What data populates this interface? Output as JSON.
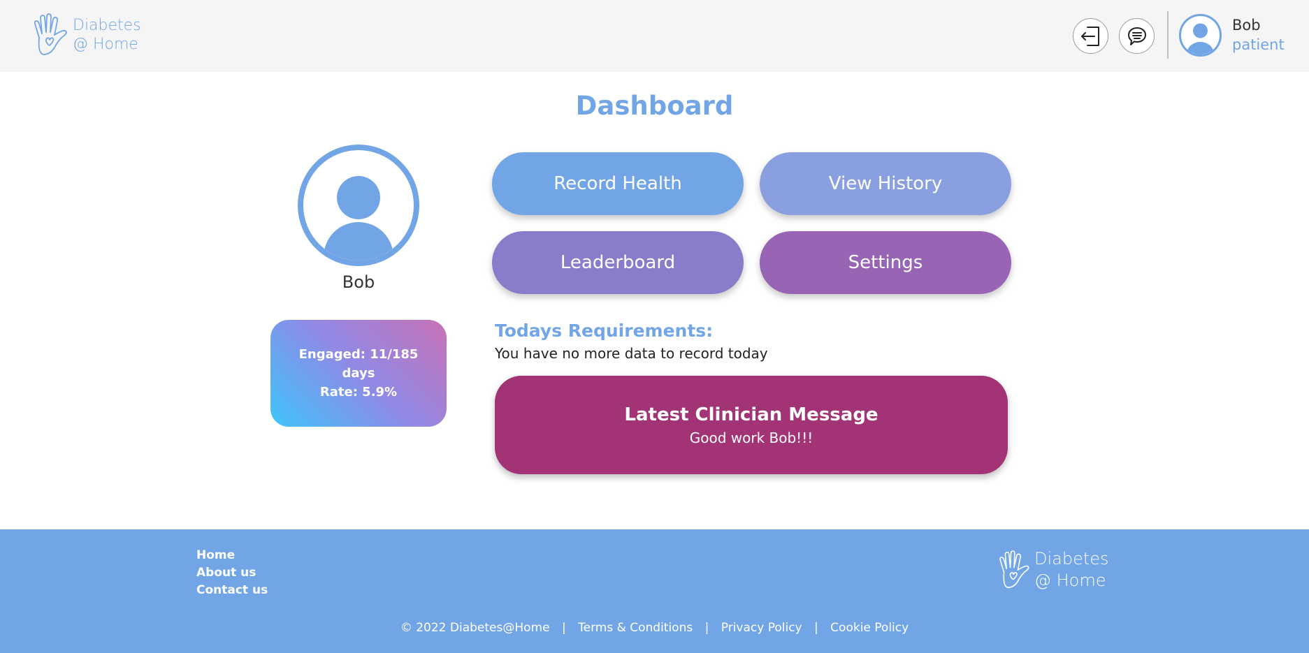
{
  "header": {
    "brand_line1": "Diabetes",
    "brand_line2": "@ Home",
    "logout_icon": "logout-icon",
    "messages_icon": "chat-bubble-icon",
    "user_name": "Bob",
    "user_role": "patient"
  },
  "main": {
    "title": "Dashboard",
    "profile_name": "Bob",
    "stats": {
      "engaged": "Engaged: 11/185 days",
      "rate": "Rate: 5.9%"
    },
    "tiles": {
      "record_health": "Record Health",
      "view_history": "View History",
      "leaderboard": "Leaderboard",
      "settings": "Settings"
    },
    "requirements": {
      "title": "Todays Requirements:",
      "text": "You have no more data to record today"
    },
    "clinician_message": {
      "title": "Latest Clinician Message",
      "body": "Good work Bob!!!"
    }
  },
  "footer": {
    "links": [
      "Home",
      "About us",
      "Contact us"
    ],
    "brand_line1": "Diabetes",
    "brand_line2": "@ Home",
    "copyright": "© 2022 Diabetes@Home",
    "terms": "Terms & Conditions",
    "privacy": "Privacy Policy",
    "cookie": "Cookie Policy",
    "separator": "|"
  },
  "colors": {
    "accent": "#72a5e6",
    "header_bg": "#f5f5f5",
    "message_card": "#a23374",
    "tile_record": "#72a5e6",
    "tile_history": "#8a9fdf",
    "tile_leaderboard": "#8b7bcb",
    "tile_settings": "#9765b3"
  }
}
